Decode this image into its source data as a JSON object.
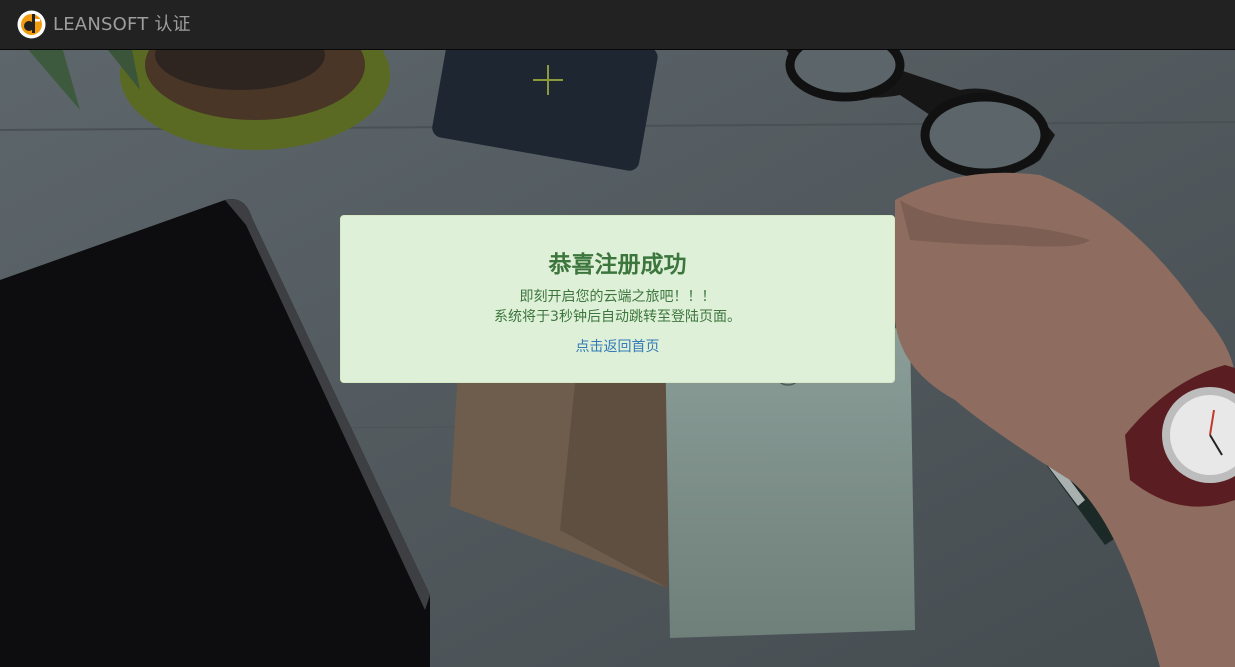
{
  "navbar": {
    "brand_text": "LEANSOFT 认证",
    "logo_icon": "leansoft-logo-icon"
  },
  "alert": {
    "title": "恭喜注册成功",
    "message_line1": "即刻开启您的云端之旅吧！！！",
    "message_line2": "系统将于3秒钟后自动跳转至登陆页面。",
    "home_link": "点击返回首页"
  },
  "colors": {
    "navbar_bg": "#222222",
    "navbar_text": "#9d9d9d",
    "alert_bg": "#dff0d8",
    "alert_text": "#3c763d",
    "link": "#337ab7",
    "logo_orange": "#f39c12"
  }
}
